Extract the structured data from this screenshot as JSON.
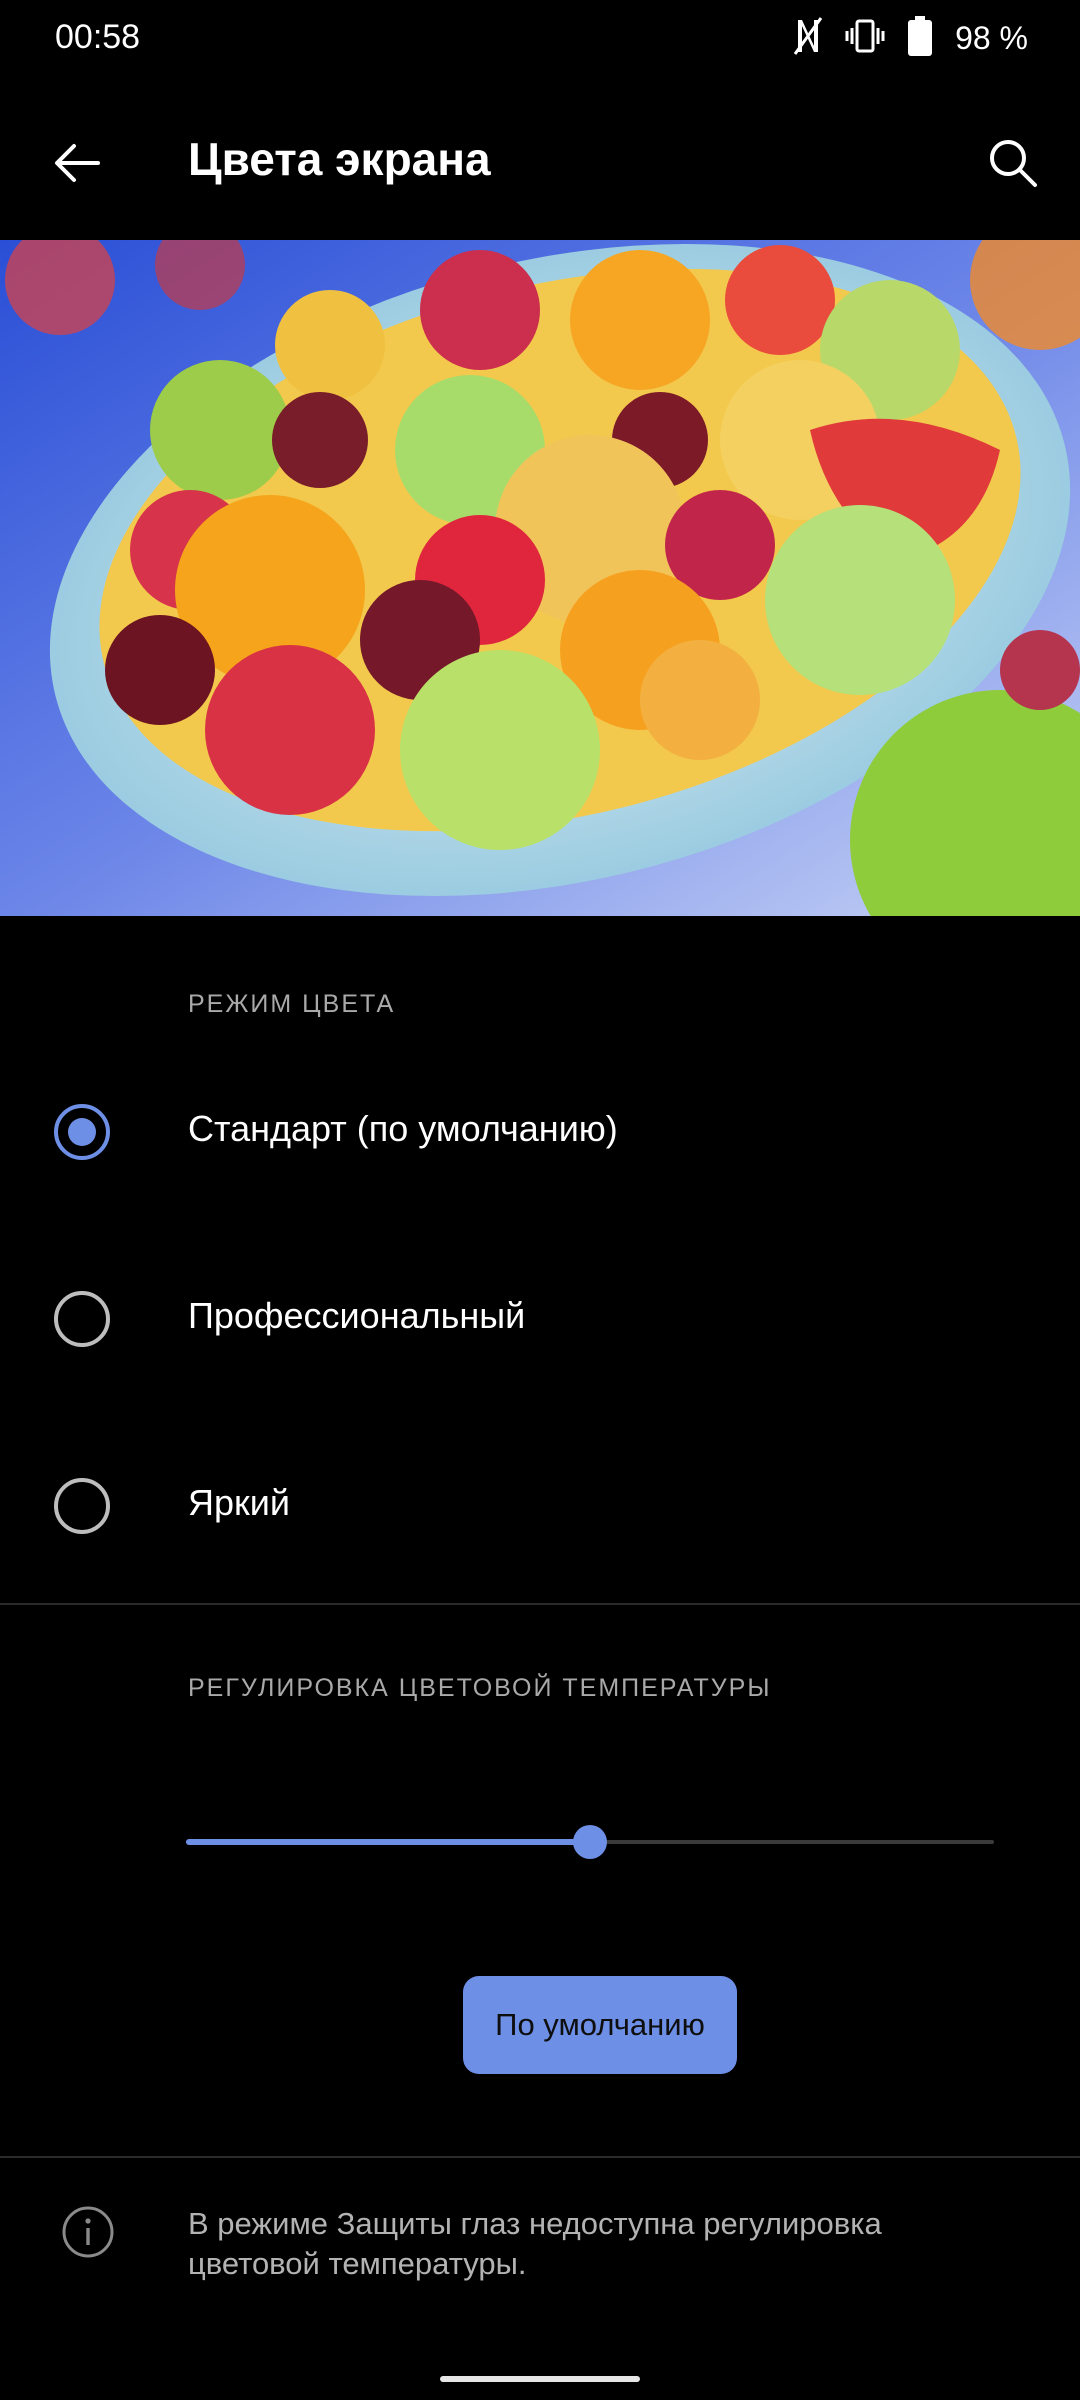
{
  "status_bar": {
    "time": "00:58",
    "battery_text": "98 %",
    "icons": [
      "nfc-icon",
      "vibrate-icon",
      "battery-icon"
    ]
  },
  "app_bar": {
    "title": "Цвета экрана",
    "back_icon": "arrow-left-icon",
    "search_icon": "search-icon"
  },
  "color_mode": {
    "header": "РЕЖИМ ЦВЕТА",
    "options": [
      {
        "label": "Стандарт (по умолчанию)",
        "selected": true
      },
      {
        "label": "Профессиональный",
        "selected": false
      },
      {
        "label": "Яркий",
        "selected": false
      }
    ]
  },
  "temperature": {
    "header": "РЕГУЛИРОВКА ЦВЕТОВОЙ ТЕМПЕРАТУРЫ",
    "slider_value": 0.5,
    "default_button": "По умолчанию"
  },
  "info": {
    "icon": "info-icon",
    "text": "В режиме Защиты глаз недоступна регулировка цветовой температуры."
  },
  "colors": {
    "accent": "#6d8fe6",
    "background": "#000000"
  }
}
